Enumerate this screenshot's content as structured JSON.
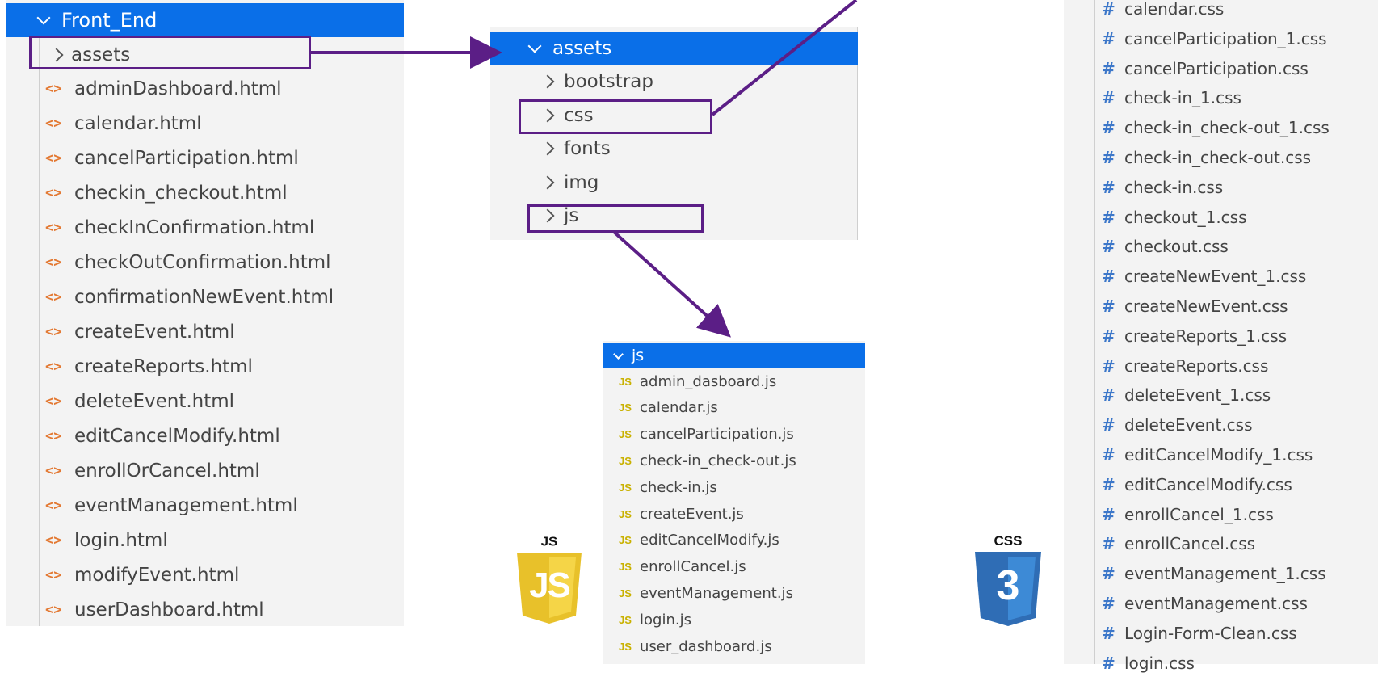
{
  "front_end": {
    "folder": "Front_End",
    "assets_label": "assets",
    "files": [
      "adminDashboard.html",
      "calendar.html",
      "cancelParticipation.html",
      "checkin_checkout.html",
      "checkInConfirmation.html",
      "checkOutConfirmation.html",
      "confirmationNewEvent.html",
      "createEvent.html",
      "createReports.html",
      "deleteEvent.html",
      "editCancelModify.html",
      "enrollOrCancel.html",
      "eventManagement.html",
      "login.html",
      "modifyEvent.html",
      "userDashboard.html"
    ]
  },
  "assets": {
    "folder": "assets",
    "subfolders": [
      "bootstrap",
      "css",
      "fonts",
      "img",
      "js"
    ]
  },
  "js": {
    "folder": "js",
    "files": [
      "admin_dasboard.js",
      "calendar.js",
      "cancelParticipation.js",
      "check-in_check-out.js",
      "check-in.js",
      "createEvent.js",
      "editCancelModify.js",
      "enrollCancel.js",
      "eventManagement.js",
      "login.js",
      "user_dashboard.js"
    ]
  },
  "css": {
    "files": [
      "calendar.css",
      "cancelParticipation_1.css",
      "cancelParticipation.css",
      "check-in_1.css",
      "check-in_check-out_1.css",
      "check-in_check-out.css",
      "check-in.css",
      "checkout_1.css",
      "checkout.css",
      "createNewEvent_1.css",
      "createNewEvent.css",
      "createReports_1.css",
      "createReports.css",
      "deleteEvent_1.css",
      "deleteEvent.css",
      "editCancelModify_1.css",
      "editCancelModify.css",
      "enrollCancel_1.css",
      "enrollCancel.css",
      "eventManagement_1.css",
      "eventManagement.css",
      "Login-Form-Clean.css",
      "login.css"
    ]
  },
  "logos": {
    "js_top": "JS",
    "js_shield": "JS",
    "css_top": "CSS",
    "css_shield": "3"
  },
  "icons": {
    "html_file": "html-file-icon",
    "js_file": "js-file-icon",
    "css_file": "css-file-icon",
    "folder_chevron": "chevron-icon"
  },
  "colors": {
    "selection": "#0a6fe8",
    "highlight_box": "#5b1e86",
    "arrow": "#5b1e86",
    "js_logo": "#e8c12a",
    "css_logo": "#2f6db5"
  }
}
